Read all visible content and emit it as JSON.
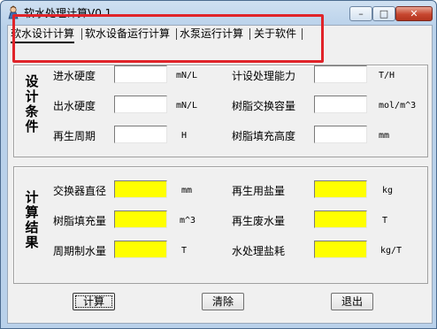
{
  "window": {
    "title": "软水处理计算V0.1",
    "minimize": "–",
    "maximize": "□",
    "close": "✕"
  },
  "tabs": [
    {
      "label": "软水设计计算"
    },
    {
      "label": "软水设备运行计算"
    },
    {
      "label": "水泵运行计算"
    },
    {
      "label": "关于软件"
    }
  ],
  "design": {
    "title": "设计条件",
    "rows": [
      {
        "left_label": "进水硬度",
        "left_value": "",
        "left_unit": "mN/L",
        "right_label": "计设处理能力",
        "right_value": "",
        "right_unit": "T/H"
      },
      {
        "left_label": "出水硬度",
        "left_value": "",
        "left_unit": "mN/L",
        "right_label": "树脂交换容量",
        "right_value": "",
        "right_unit": "mol/m^3"
      },
      {
        "left_label": "再生周期",
        "left_value": "",
        "left_unit": "H",
        "right_label": "树脂填充高度",
        "right_value": "",
        "right_unit": "mm"
      }
    ]
  },
  "result": {
    "title": "计算结果",
    "rows": [
      {
        "left_label": "交换器直径",
        "left_value": "",
        "left_unit": "mm",
        "right_label": "再生用盐量",
        "right_value": "",
        "right_unit": "kg"
      },
      {
        "left_label": "树脂填充量",
        "left_value": "",
        "left_unit": "m^3",
        "right_label": "再生废水量",
        "right_value": "",
        "right_unit": "T"
      },
      {
        "left_label": "周期制水量",
        "left_value": "",
        "left_unit": "T",
        "right_label": "水处理盐耗",
        "right_value": "",
        "right_unit": "kg/T"
      }
    ]
  },
  "buttons": {
    "calculate": "计算",
    "clear": "清除",
    "exit": "退出"
  },
  "colors": {
    "output_field": "#ffff00",
    "highlight_box": "#e0242a"
  }
}
